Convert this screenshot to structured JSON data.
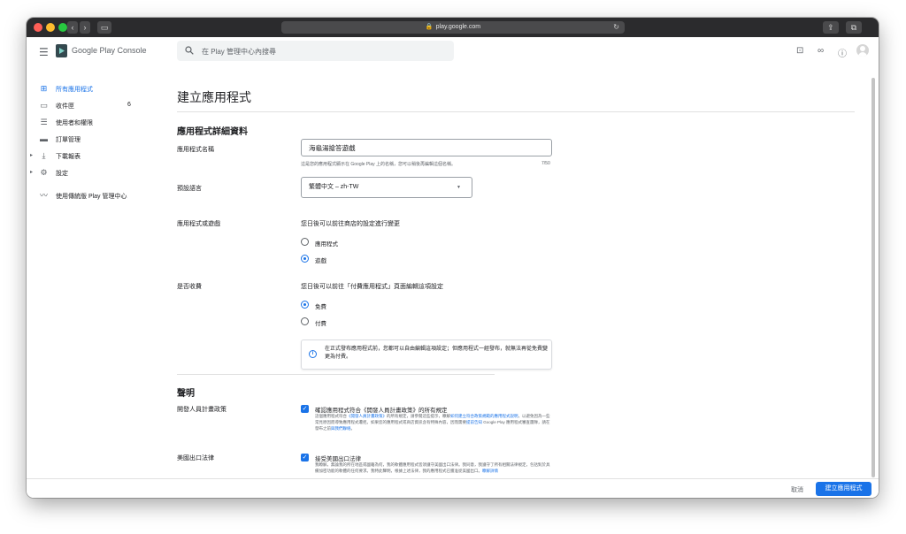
{
  "browser": {
    "url": "play.google.com"
  },
  "header": {
    "brand": "Google Play Console",
    "search_placeholder": "在 Play 管理中心內搜尋"
  },
  "sidebar": {
    "items": [
      {
        "label": "所有應用程式",
        "icon": "apps-grid-icon",
        "active": true
      },
      {
        "label": "收件匣",
        "icon": "inbox-icon",
        "count": "6"
      },
      {
        "label": "使用者和權限",
        "icon": "users-icon"
      },
      {
        "label": "訂單管理",
        "icon": "credit-card-icon"
      },
      {
        "label": "下載報表",
        "icon": "download-icon"
      },
      {
        "label": "設定",
        "icon": "gear-icon"
      },
      {
        "label": "使用傳統版 Play 管理中心",
        "icon": "trending-icon"
      }
    ]
  },
  "main": {
    "title": "建立應用程式",
    "details_section": "應用程式詳細資料",
    "app_name": {
      "label": "應用程式名稱",
      "value": "海龜湯搶答遊戲",
      "helper": "這是您的應用程式顯示在 Google Play 上的名稱，您可以稍後再編輯這個名稱。",
      "counter": "7/50"
    },
    "default_language": {
      "label": "預設語言",
      "value": "繁體中文 – zh-TW"
    },
    "app_or_game": {
      "label": "應用程式或遊戲",
      "description": "您日後可以前往商店的設定進行變更",
      "options": [
        {
          "label": "應用程式",
          "selected": false
        },
        {
          "label": "遊戲",
          "selected": true
        }
      ]
    },
    "free_or_paid": {
      "label": "是否收費",
      "description": "您日後可以前往「付費應用程式」頁面編輯這項設定",
      "options": [
        {
          "label": "免費",
          "selected": true
        },
        {
          "label": "付費",
          "selected": false
        }
      ],
      "info": "在正式發布應用程式前，您都可以自由編輯這項設定；但應用程式一經發布，就無法再從免費變更為付費。"
    },
    "declarations_section": "聲明",
    "developer_policy": {
      "label": "開發人員計畫政策",
      "checkbox_title": "確認應用程式符合《開發人員計畫政策》的所有規定",
      "desc_1": "這個應用程式符合",
      "desc_link_1": "《開發人員計畫政策》",
      "desc_2": "的所有規定，請參閱這些提示，瞭解",
      "desc_link_2": "如何建立符合政策規範的應用程式說明",
      "desc_3": "，以避免因為一些常見原因而導致應用程式遭拒。如果您的應用程式或商店資訊含有特殊內容，因而需要",
      "desc_link_3": "提前告知",
      "desc_4": " Google Play 應用程式審查團隊，請在發布之前",
      "desc_link_4": "與我們聯絡",
      "desc_5": "。"
    },
    "export_laws": {
      "label": "美國出口法律",
      "checkbox_title": "接受美國出口法律",
      "desc_1": "我瞭解，無論我的所在地區或國籍為何，我的軟體應用程式皆須遵守美國出口法律。我同意，我遵守了所有相關法律規定，包括對於具備加密功能的軟體的任何要求。我特此聲明，根據上述法律，我的應用程式已獲准從美國出口。",
      "desc_link": "瞭解詳情"
    }
  },
  "footer": {
    "cancel": "取消",
    "create": "建立應用程式"
  }
}
